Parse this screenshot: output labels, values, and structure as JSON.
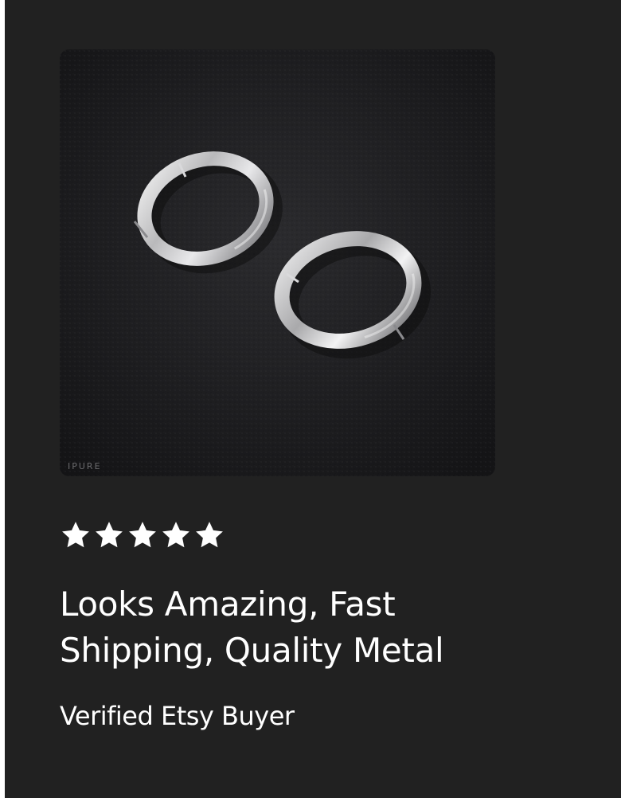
{
  "review": {
    "product_image": {
      "alt": "Silver hoop earrings",
      "watermark": "IPURE"
    },
    "rating": {
      "value": 5,
      "max": 5
    },
    "title": "Looks Amazing, Fast Shipping, Quality Metal",
    "reviewer": "Verified Etsy Buyer"
  },
  "colors": {
    "background": "#212121",
    "text": "#ffffff",
    "star": "#ffffff"
  }
}
